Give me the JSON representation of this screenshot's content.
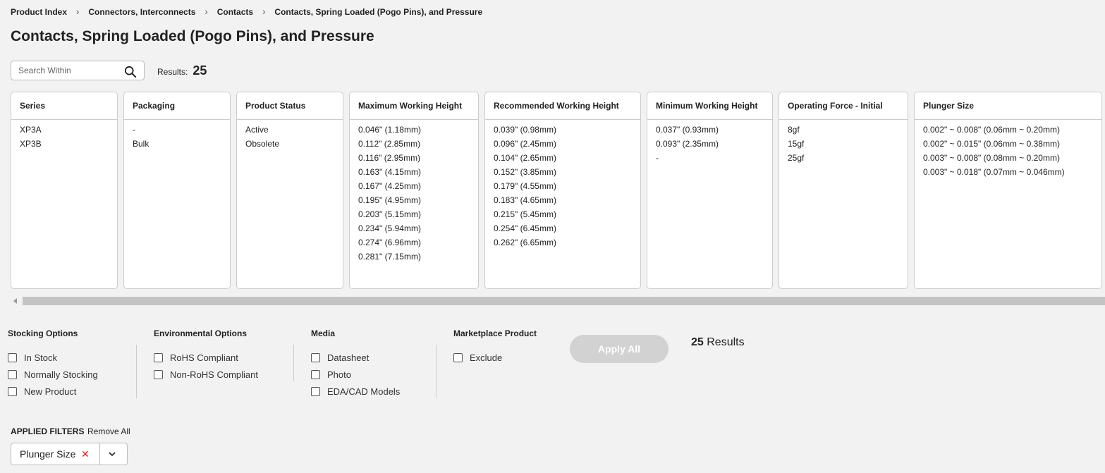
{
  "breadcrumb": [
    "Product Index",
    "Connectors, Interconnects",
    "Contacts",
    "Contacts, Spring Loaded (Pogo Pins), and Pressure"
  ],
  "page_title": "Contacts, Spring Loaded (Pogo Pins), and Pressure",
  "search": {
    "placeholder": "Search Within",
    "value": ""
  },
  "results": {
    "label": "Results:",
    "count": "25"
  },
  "filters": [
    {
      "title": "Series",
      "options": [
        "XP3A",
        "XP3B"
      ]
    },
    {
      "title": "Packaging",
      "options": [
        "-",
        "Bulk"
      ]
    },
    {
      "title": "Product Status",
      "options": [
        "Active",
        "Obsolete"
      ]
    },
    {
      "title": "Maximum Working Height",
      "options": [
        "0.046\" (1.18mm)",
        "0.112\" (2.85mm)",
        "0.116\" (2.95mm)",
        "0.163\" (4.15mm)",
        "0.167\" (4.25mm)",
        "0.195\" (4.95mm)",
        "0.203\" (5.15mm)",
        "0.234\" (5.94mm)",
        "0.274\" (6.96mm)",
        "0.281\" (7.15mm)"
      ]
    },
    {
      "title": "Recommended Working Height",
      "options": [
        "0.039\" (0.98mm)",
        "0.096\" (2.45mm)",
        "0.104\" (2.65mm)",
        "0.152\" (3.85mm)",
        "0.179\" (4.55mm)",
        "0.183\" (4.65mm)",
        "0.215\" (5.45mm)",
        "0.254\" (6.45mm)",
        "0.262\" (6.65mm)"
      ]
    },
    {
      "title": "Minimum Working Height",
      "options": [
        "0.037\" (0.93mm)",
        "0.093\" (2.35mm)",
        "-"
      ]
    },
    {
      "title": "Operating Force - Initial",
      "options": [
        "8gf",
        "15gf",
        "25gf"
      ]
    },
    {
      "title": "Plunger Size",
      "options": [
        "0.002\" ~ 0.008\" (0.06mm ~ 0.20mm)",
        "0.002\" ~ 0.015\" (0.06mm ~ 0.38mm)",
        "0.003\" ~ 0.008\" (0.08mm ~ 0.20mm)",
        "0.003\" ~ 0.018\" (0.07mm ~ 0.046mm)"
      ]
    }
  ],
  "options": {
    "stocking": {
      "title": "Stocking Options",
      "items": [
        "In Stock",
        "Normally Stocking",
        "New Product"
      ]
    },
    "environmental": {
      "title": "Environmental Options",
      "items": [
        "RoHS Compliant",
        "Non-RoHS Compliant"
      ]
    },
    "media": {
      "title": "Media",
      "items": [
        "Datasheet",
        "Photo",
        "EDA/CAD Models"
      ]
    },
    "marketplace": {
      "title": "Marketplace Product",
      "items": [
        "Exclude"
      ]
    }
  },
  "apply_all_label": "Apply All",
  "results_bottom": {
    "count": "25",
    "label": "Results"
  },
  "applied_filters": {
    "label": "APPLIED FILTERS",
    "remove_all": "Remove All",
    "chips": [
      "Plunger Size"
    ]
  },
  "colors": {
    "background": "#f2f2f2",
    "card_border": "#cccccc",
    "apply_disabled": "#d2d2d2",
    "chip_close": "#e02020"
  }
}
